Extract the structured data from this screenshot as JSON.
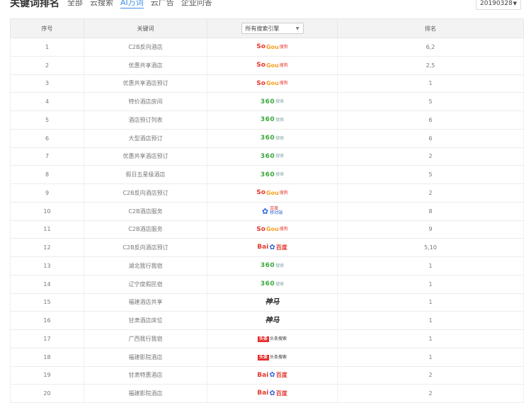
{
  "header": {
    "title": "关键词排名",
    "tabs": [
      "全部",
      "云搜索",
      "AI万词",
      "云广告",
      "企业问答"
    ],
    "active_tab": 2,
    "date_value": "20190328"
  },
  "table": {
    "columns": [
      "序号",
      "关键词",
      "所有搜索引擎",
      "排名"
    ],
    "engine_filter": "所有搜索引擎",
    "rows": [
      {
        "no": "1",
        "keyword": "C2B反向酒店",
        "engine": "sogou",
        "rank": "6,2"
      },
      {
        "no": "2",
        "keyword": "优惠共享酒店",
        "engine": "sogou",
        "rank": "2,5"
      },
      {
        "no": "3",
        "keyword": "优惠共享酒店预订",
        "engine": "sogou",
        "rank": "1"
      },
      {
        "no": "4",
        "keyword": "特价酒店房间",
        "engine": "360",
        "rank": "5"
      },
      {
        "no": "5",
        "keyword": "酒店预订列表",
        "engine": "360",
        "rank": "6"
      },
      {
        "no": "6",
        "keyword": "大型酒店预订",
        "engine": "360",
        "rank": "6"
      },
      {
        "no": "7",
        "keyword": "优惠共享酒店预订",
        "engine": "360",
        "rank": "2"
      },
      {
        "no": "8",
        "keyword": "假日五星级酒店",
        "engine": "360",
        "rank": "5"
      },
      {
        "no": "9",
        "keyword": "C2B反向酒店预订",
        "engine": "sogou",
        "rank": "2"
      },
      {
        "no": "10",
        "keyword": "C2B酒店服务",
        "engine": "baidu-mobile",
        "rank": "8"
      },
      {
        "no": "11",
        "keyword": "C2B酒店服务",
        "engine": "sogou",
        "rank": "9"
      },
      {
        "no": "12",
        "keyword": "C2B反向酒店预订",
        "engine": "baidu",
        "rank": "5,10"
      },
      {
        "no": "13",
        "keyword": "湖北我行我宿",
        "engine": "360",
        "rank": "1"
      },
      {
        "no": "14",
        "keyword": "辽宁度假民宿",
        "engine": "360",
        "rank": "1"
      },
      {
        "no": "15",
        "keyword": "福建酒店共享",
        "engine": "shenma",
        "rank": "1"
      },
      {
        "no": "16",
        "keyword": "甘肃酒店床位",
        "engine": "shenma",
        "rank": "1"
      },
      {
        "no": "17",
        "keyword": "广西我行我宿",
        "engine": "toutiao",
        "rank": "1"
      },
      {
        "no": "18",
        "keyword": "福建影院酒店",
        "engine": "toutiao",
        "rank": "1"
      },
      {
        "no": "19",
        "keyword": "甘肃特惠酒店",
        "engine": "baidu",
        "rank": "2"
      },
      {
        "no": "20",
        "keyword": "福建影院酒店",
        "engine": "baidu",
        "rank": "2"
      }
    ]
  },
  "logos": {
    "sogou": {
      "a": "So",
      "b": "Gou",
      "c": "搜狗"
    },
    "360": {
      "a": "360",
      "b": "搜索"
    },
    "baidu-mobile": {
      "a": "百度",
      "b": "移动端"
    },
    "baidu": {
      "a": "Bai",
      "b": "百度"
    },
    "shenma": {
      "a": "神马"
    },
    "toutiao": {
      "a": "头条",
      "b": "头条搜索"
    }
  }
}
